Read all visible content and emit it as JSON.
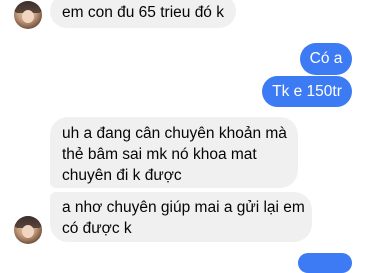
{
  "messages": [
    {
      "side": "in",
      "lines": [
        "em con đu 65 trieu đó k"
      ]
    },
    {
      "side": "out",
      "lines": [
        "Có a"
      ]
    },
    {
      "side": "out",
      "lines": [
        "Tk e 150tr"
      ]
    },
    {
      "side": "in",
      "lines": [
        "uh a đang cân chuyên khoản mà",
        "thẻ bâm sai mk nó khoa mat",
        "chuyên đi k được"
      ]
    },
    {
      "side": "in",
      "lines": [
        "a nhơ chuyên giúp mai a gửi lại em",
        "có được k"
      ]
    }
  ],
  "colors": {
    "incoming_bubble": "#f0f0f0",
    "outgoing_bubble": "#3d7bf5",
    "outgoing_text": "#ffffff"
  }
}
